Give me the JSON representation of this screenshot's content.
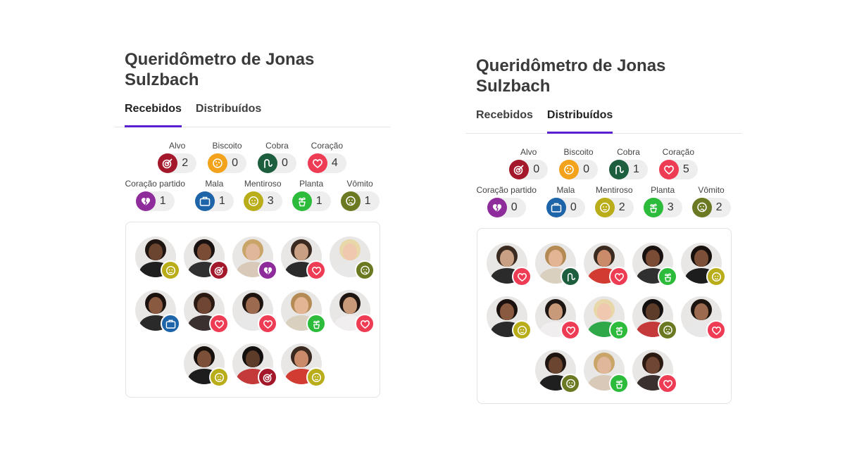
{
  "icon_colors": {
    "alvo": "#a3182a",
    "biscoito": "#f2a21b",
    "cobra": "#1d5e3f",
    "coracao": "#ef3c55",
    "coracao-partido": "#8e2c9c",
    "mala": "#1d64a8",
    "mentiroso": "#b9ad19",
    "planta": "#2dbb3b",
    "vomito": "#6b7a22"
  },
  "panels": [
    {
      "title": "Queridômetro de Jonas Sulzbach",
      "tabs": [
        {
          "label": "Recebidos",
          "active": true
        },
        {
          "label": "Distribuídos",
          "active": false
        }
      ],
      "stats_row1": [
        {
          "label": "Alvo",
          "icon": "alvo",
          "count": "2"
        },
        {
          "label": "Biscoito",
          "icon": "biscoito",
          "count": "0"
        },
        {
          "label": "Cobra",
          "icon": "cobra",
          "count": "0"
        },
        {
          "label": "Coração",
          "icon": "coracao",
          "count": "4"
        }
      ],
      "stats_row2": [
        {
          "label": "Coração partido",
          "icon": "coracao-partido",
          "count": "1"
        },
        {
          "label": "Mala",
          "icon": "mala",
          "count": "1"
        },
        {
          "label": "Mentiroso",
          "icon": "mentiroso",
          "count": "3"
        },
        {
          "label": "Planta",
          "icon": "planta",
          "count": "1"
        },
        {
          "label": "Vômito",
          "icon": "vomito",
          "count": "1"
        }
      ],
      "faces": [
        [
          {
            "badge": "mentiroso",
            "skin": "#6b4530",
            "hair": "#1e1410",
            "shirt": "#1f1f1f"
          },
          {
            "badge": "alvo",
            "skin": "#7a4c35",
            "hair": "#1a1210",
            "shirt": "#303030"
          },
          {
            "badge": "coracao-partido",
            "skin": "#e0b79a",
            "hair": "#c9a56a",
            "shirt": "#d8c9b8"
          },
          {
            "badge": "coracao",
            "skin": "#caa085",
            "hair": "#3b2a20",
            "shirt": "#2b2b2b"
          },
          {
            "badge": "vomito",
            "skin": "#f0c8b0",
            "hair": "#e8d7a8",
            "shirt": "#e8e8e8"
          }
        ],
        [
          {
            "badge": "mala",
            "skin": "#8a5a40",
            "hair": "#1b1210",
            "shirt": "#2a2a2a"
          },
          {
            "badge": "coracao",
            "skin": "#6e4633",
            "hair": "#2a1a12",
            "shirt": "#3a3030"
          },
          {
            "badge": "coracao",
            "skin": "#9c6a4e",
            "hair": "#1d1410",
            "shirt": "#e8e8e8"
          },
          {
            "badge": "planta",
            "skin": "#e3b594",
            "hair": "#b48a55",
            "shirt": "#d9d0c0"
          },
          {
            "badge": "coracao",
            "skin": "#c99a7a",
            "hair": "#1e1612",
            "shirt": "#f0eeee"
          }
        ],
        [
          {
            "badge": "mentiroso",
            "skin": "#7c5038",
            "hair": "#17100d",
            "shirt": "#1d1d1d"
          },
          {
            "badge": "alvo",
            "skin": "#5e3c2a",
            "hair": "#141010",
            "shirt": "#c43a3a"
          },
          {
            "badge": "mentiroso",
            "skin": "#c98b6a",
            "hair": "#3a2a20",
            "shirt": "#d23b32"
          }
        ]
      ]
    },
    {
      "title": "Queridômetro de Jonas Sulzbach",
      "tabs": [
        {
          "label": "Recebidos",
          "active": false
        },
        {
          "label": "Distribuídos",
          "active": true
        }
      ],
      "stats_row1": [
        {
          "label": "Alvo",
          "icon": "alvo",
          "count": "0"
        },
        {
          "label": "Biscoito",
          "icon": "biscoito",
          "count": "0"
        },
        {
          "label": "Cobra",
          "icon": "cobra",
          "count": "1"
        },
        {
          "label": "Coração",
          "icon": "coracao",
          "count": "5"
        }
      ],
      "stats_row2": [
        {
          "label": "Coração partido",
          "icon": "coracao-partido",
          "count": "0"
        },
        {
          "label": "Mala",
          "icon": "mala",
          "count": "0"
        },
        {
          "label": "Mentiroso",
          "icon": "mentiroso",
          "count": "2"
        },
        {
          "label": "Planta",
          "icon": "planta",
          "count": "3"
        },
        {
          "label": "Vômito",
          "icon": "vomito",
          "count": "2"
        }
      ],
      "faces": [
        [
          {
            "badge": "coracao",
            "skin": "#caa085",
            "hair": "#3b2a20",
            "shirt": "#2b2b2b"
          },
          {
            "badge": "cobra",
            "skin": "#e3b594",
            "hair": "#b48a55",
            "shirt": "#d9d0c0"
          },
          {
            "badge": "coracao",
            "skin": "#c98b6a",
            "hair": "#3a2a20",
            "shirt": "#d23b32"
          },
          {
            "badge": "planta",
            "skin": "#7a4c35",
            "hair": "#1a1210",
            "shirt": "#303030"
          },
          {
            "badge": "mentiroso",
            "skin": "#7c5038",
            "hair": "#17100d",
            "shirt": "#1d1d1d"
          }
        ],
        [
          {
            "badge": "mentiroso",
            "skin": "#8a5a40",
            "hair": "#1b1210",
            "shirt": "#2a2a2a"
          },
          {
            "badge": "coracao",
            "skin": "#c99a7a",
            "hair": "#1e1612",
            "shirt": "#f0eeee"
          },
          {
            "badge": "planta",
            "skin": "#f0c8b0",
            "hair": "#e8d7a8",
            "shirt": "#2fa84a"
          },
          {
            "badge": "vomito",
            "skin": "#5e3c2a",
            "hair": "#141010",
            "shirt": "#c43a3a"
          },
          {
            "badge": "coracao",
            "skin": "#9c6a4e",
            "hair": "#1d1410",
            "shirt": "#e8e8e8"
          }
        ],
        [
          {
            "badge": "vomito",
            "skin": "#6b4530",
            "hair": "#1e1410",
            "shirt": "#1f1f1f"
          },
          {
            "badge": "planta",
            "skin": "#e0b79a",
            "hair": "#c9a56a",
            "shirt": "#d8c9b8"
          },
          {
            "badge": "coracao",
            "skin": "#6e4633",
            "hair": "#2a1a12",
            "shirt": "#3a3030"
          }
        ]
      ]
    }
  ]
}
